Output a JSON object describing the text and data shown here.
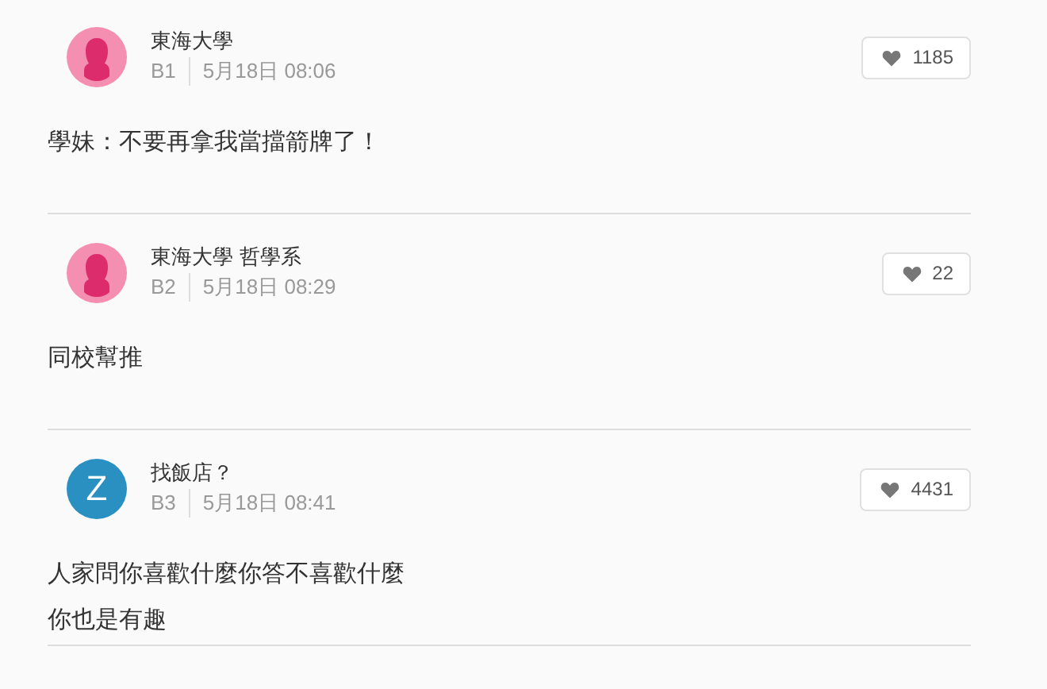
{
  "comments": [
    {
      "avatar": {
        "kind": "female"
      },
      "author": "東海大學",
      "floor": "B1",
      "time": "5月18日 08:06",
      "likes": "1185",
      "body": [
        "學妹：不要再拿我當擋箭牌了！"
      ]
    },
    {
      "avatar": {
        "kind": "female"
      },
      "author": "東海大學 哲學系",
      "floor": "B2",
      "time": "5月18日 08:29",
      "likes": "22",
      "body": [
        "同校幫推"
      ]
    },
    {
      "avatar": {
        "kind": "letter",
        "letter": "Z"
      },
      "author": "找飯店？",
      "floor": "B3",
      "time": "5月18日 08:41",
      "likes": "4431",
      "body": [
        "人家問你喜歡什麼你答不喜歡什麼",
        "你也是有趣"
      ]
    }
  ]
}
